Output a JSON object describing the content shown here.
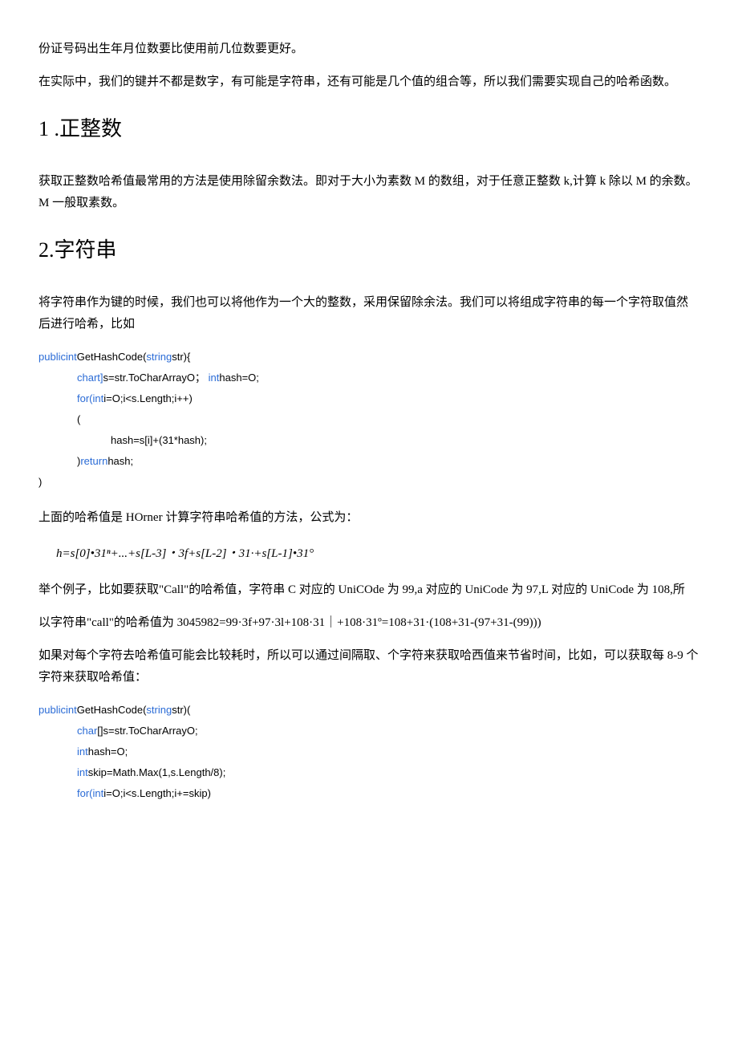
{
  "p1": "份证号码出生年月位数要比使用前几位数要更好。",
  "p2": "在实际中，我们的键并不都是数字，有可能是字符串，还有可能是几个值的组合等，所以我们需要实现自己的哈希函数。",
  "h1": "1 .正整数",
  "p3": "获取正整数哈希值最常用的方法是使用除留余数法。即对于大小为素数 M 的数组，对于任意正整数 k,计算 k 除以 M 的余数。M 一般取素数。",
  "h2": "2.字符串",
  "p4": "将字符串作为键的时候，我们也可以将他作为一个大的整数，采用保留除余法。我们可以将组成字符串的每一个字符取值然后进行哈希，比如",
  "code1": {
    "l1a": "publicint",
    "l1b": "GetHashCode(",
    "l1c": "string",
    "l1d": "str){",
    "l2a": "chart]",
    "l2b": "s=str.ToCharArrayO；",
    "l2c": "int",
    "l2d": "hash=O;",
    "l3a": "for(int",
    "l3b": "i=O;i<s.Length;i++)",
    "l4": "(",
    "l5": "hash=s[i]+(31*hash);",
    "l6a": ")",
    "l6b": "return",
    "l6c": "hash;",
    "l7": ")"
  },
  "p5": "上面的哈希值是 HOrner 计算字符串哈希值的方法，公式为：",
  "formula": "h=s[0]•31ⁿ+...+s[L-3]・3f+s[L-2]・31·+s[L-1]•31°",
  "p6": "举个例子，比如要获取\"Call\"的哈希值，字符串 C 对应的 UniCOde 为 99,a 对应的 UniCode 为 97,L 对应的 UniCode 为 108,所",
  "p7": "以字符串\"call\"的哈希值为 3045982=99·3f+97·3l+108·31｜+108·31º=108+31·(108+31-(97+31-(99)))",
  "p8": "如果对每个字符去哈希值可能会比较耗时，所以可以通过间隔取、个字符来获取哈西值来节省时间，比如，可以获取每 8-9 个字符来获取哈希值：",
  "code2": {
    "l1a": "publicint",
    "l1b": "GetHashCode(",
    "l1c": "string",
    "l1d": "str)(",
    "l2a": "char",
    "l2b": "[]s=str.ToCharArrayO;",
    "l3a": "int",
    "l3b": "hash=O;",
    "l4a": "int",
    "l4b": "skip=Math.Max(1,s.Length/8);",
    "l5a": "for(int",
    "l5b": "i=O;i<s.Length;i+=skip)"
  }
}
